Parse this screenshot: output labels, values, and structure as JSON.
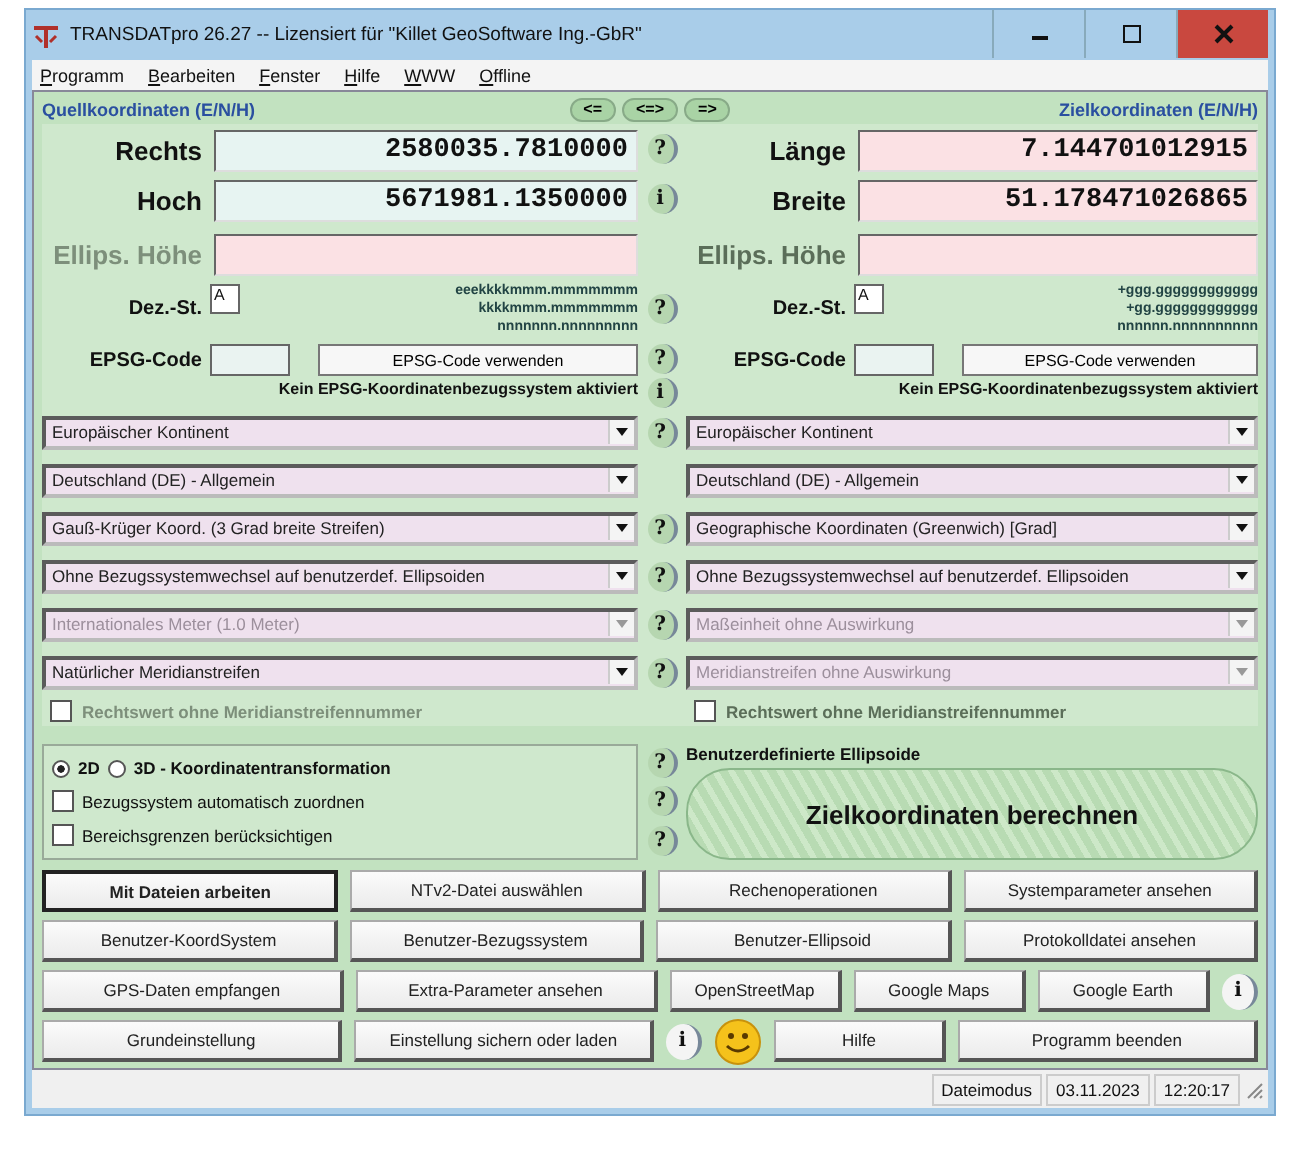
{
  "window": {
    "title": "TRANSDATpro 26.27 -- Lizensiert für \"Killet GeoSoftware Ing.-GbR\""
  },
  "menu": [
    "Programm",
    "Bearbeiten",
    "Fenster",
    "Hilfe",
    "WWW",
    "Offline"
  ],
  "swap_buttons": [
    "<=",
    "<=>",
    "=>"
  ],
  "source": {
    "heading": "Quellkoordinaten (E/N/H)",
    "coords": [
      {
        "label": "Rechts",
        "value": "2580035.7810000",
        "help": "?"
      },
      {
        "label": "Hoch",
        "value": "5671981.1350000",
        "help": "i"
      }
    ],
    "height": {
      "label": "Ellips. Höhe",
      "disabled": true
    },
    "decimals": {
      "label": "Dez.-St.",
      "value": "A",
      "pattern": [
        "eeekkkkmmm.mmmmmmm",
        "kkkkmmm.mmmmmmm",
        "nnnnnnn.nnnnnnnnn"
      ],
      "help": "?"
    },
    "epsg": {
      "label": "EPSG-Code",
      "button": "EPSG-Code verwenden",
      "note": "Kein EPSG-Koordinatenbezugssystem aktiviert",
      "help": "?",
      "note_help": "i"
    },
    "dropdowns": [
      {
        "value": "Europäischer Kontinent",
        "disabled": false,
        "help": "?"
      },
      {
        "value": "Deutschland (DE) - Allgemein",
        "disabled": false
      },
      {
        "value": "Gauß-Krüger Koord. (3 Grad breite Streifen)",
        "disabled": false,
        "help": "?"
      },
      {
        "value": "Ohne Bezugssystemwechsel auf benutzerdef. Ellipsoiden",
        "disabled": false,
        "help": "?"
      },
      {
        "value": "Internationales Meter (1.0 Meter)",
        "disabled": true,
        "help": "?"
      },
      {
        "value": "Natürlicher Meridianstreifen",
        "disabled": false,
        "help": "?"
      }
    ],
    "checkbox": {
      "label": "Rechtswert ohne Meridianstreifennummer",
      "checked": false,
      "disabled": true
    }
  },
  "target": {
    "heading": "Zielkoordinaten (E/N/H)",
    "coords": [
      {
        "label": "Länge",
        "value": "7.144701012915"
      },
      {
        "label": "Breite",
        "value": "51.178471026865"
      }
    ],
    "height": {
      "label": "Ellips. Höhe",
      "disabled": false
    },
    "decimals": {
      "label": "Dez.-St.",
      "value": "A",
      "pattern": [
        "+ggg.gggggggggggg",
        "+gg.gggggggggggg",
        "nnnnnn.nnnnnnnnnn"
      ]
    },
    "epsg": {
      "label": "EPSG-Code",
      "button": "EPSG-Code verwenden",
      "note": "Kein EPSG-Koordinatenbezugssystem aktiviert"
    },
    "dropdowns": [
      {
        "value": "Europäischer Kontinent",
        "disabled": false
      },
      {
        "value": "Deutschland (DE) - Allgemein",
        "disabled": false
      },
      {
        "value": "Geographische Koordinaten (Greenwich) [Grad]",
        "disabled": false
      },
      {
        "value": "Ohne Bezugssystemwechsel auf benutzerdef. Ellipsoiden",
        "disabled": false
      },
      {
        "value": "Maßeinheit ohne Auswirkung",
        "disabled": true
      },
      {
        "value": "Meridianstreifen ohne Auswirkung",
        "disabled": true
      }
    ],
    "checkbox": {
      "label": "Rechtswert ohne Meridianstreifennummer",
      "checked": false,
      "disabled": false
    }
  },
  "options": {
    "radios": [
      {
        "label": "2D",
        "selected": true
      },
      {
        "label": "3D - Koordinatentransformation",
        "selected": false
      }
    ],
    "checkboxes": [
      {
        "label": "Bezugssystem automatisch zuordnen",
        "checked": false
      },
      {
        "label": "Bereichsgrenzen berücksichtigen",
        "checked": false
      }
    ],
    "help": [
      "?",
      "?",
      "?"
    ]
  },
  "custom_ellipsoids": "Benutzerdefinierte Ellipsoide",
  "compute_button": "Zielkoordinaten berechnen",
  "button_rows": [
    [
      {
        "kind": "button",
        "label": "Mit Dateien arbeiten",
        "default": true
      },
      {
        "kind": "button",
        "label": "NTv2-Datei auswählen",
        "default": false
      },
      {
        "kind": "button",
        "label": "Rechenoperationen",
        "default": false
      },
      {
        "kind": "button",
        "label": "Systemparameter ansehen",
        "default": false
      }
    ],
    [
      {
        "kind": "button",
        "label": "Benutzer-KoordSystem",
        "default": false
      },
      {
        "kind": "button",
        "label": "Benutzer-Bezugssystem",
        "default": false
      },
      {
        "kind": "button",
        "label": "Benutzer-Ellipsoid",
        "default": false
      },
      {
        "kind": "button",
        "label": "Protokolldatei ansehen",
        "default": false
      }
    ],
    [
      {
        "kind": "button",
        "label": "GPS-Daten empfangen",
        "default": false
      },
      {
        "kind": "button",
        "label": "Extra-Parameter ansehen",
        "default": false
      },
      {
        "kind": "small",
        "label": "OpenStreetMap",
        "default": false
      },
      {
        "kind": "small",
        "label": "Google Maps",
        "default": false
      },
      {
        "kind": "small",
        "label": "Google Earth",
        "default": false
      },
      {
        "kind": "info",
        "label": "i"
      }
    ],
    [
      {
        "kind": "button",
        "label": "Grundeinstellung",
        "default": false
      },
      {
        "kind": "button",
        "label": "Einstellung sichern oder laden",
        "default": false
      },
      {
        "kind": "info",
        "label": "i"
      },
      {
        "kind": "smiley"
      },
      {
        "kind": "small",
        "label": "Hilfe",
        "default": false
      },
      {
        "kind": "button",
        "label": "Programm beenden",
        "default": false
      }
    ]
  ],
  "status_bar": [
    "Dateimodus",
    "03.11.2023",
    "12:20:17"
  ]
}
